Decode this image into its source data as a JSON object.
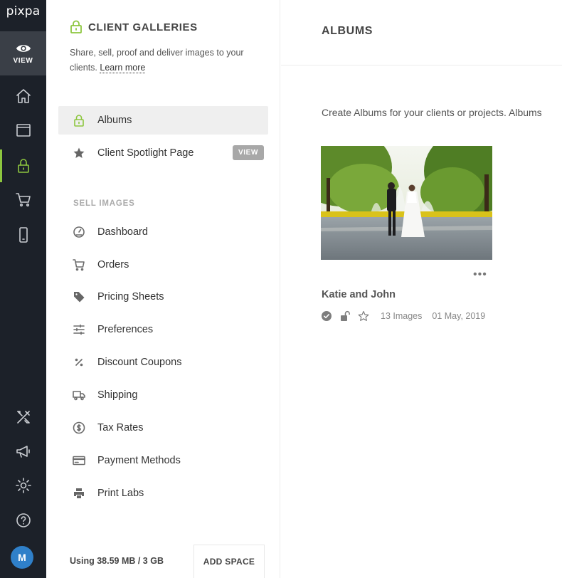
{
  "app": {
    "logo": "pixpa",
    "view_label": "VIEW",
    "avatar_initial": "M"
  },
  "sidebar": {
    "title": "CLIENT GALLERIES",
    "description": "Share, sell, proof and deliver images to your clients.",
    "learn_more": "Learn more",
    "items": [
      {
        "label": "Albums",
        "icon": "lock-icon",
        "active": true
      },
      {
        "label": "Client Spotlight Page",
        "icon": "star-icon",
        "badge": "VIEW"
      }
    ],
    "sell_section_label": "SELL IMAGES",
    "sell_items": [
      {
        "label": "Dashboard",
        "icon": "dashboard-icon"
      },
      {
        "label": "Orders",
        "icon": "cart-icon"
      },
      {
        "label": "Pricing Sheets",
        "icon": "tag-icon"
      },
      {
        "label": "Preferences",
        "icon": "sliders-icon"
      },
      {
        "label": "Discount Coupons",
        "icon": "percent-icon"
      },
      {
        "label": "Shipping",
        "icon": "truck-icon"
      },
      {
        "label": "Tax Rates",
        "icon": "dollar-icon"
      },
      {
        "label": "Payment Methods",
        "icon": "card-icon"
      },
      {
        "label": "Print Labs",
        "icon": "printer-icon"
      }
    ],
    "storage_usage": "Using 38.59 MB / 3 GB",
    "add_space": "ADD SPACE"
  },
  "main": {
    "title": "ALBUMS",
    "intro": "Create Albums for your clients or projects. Albums",
    "albums": [
      {
        "name": "Katie and John",
        "image_count": "13 Images",
        "date": "01 May, 2019"
      }
    ]
  },
  "colors": {
    "accent": "#8dc63f",
    "rail": "#1c2129",
    "avatar": "#2f80c9"
  }
}
